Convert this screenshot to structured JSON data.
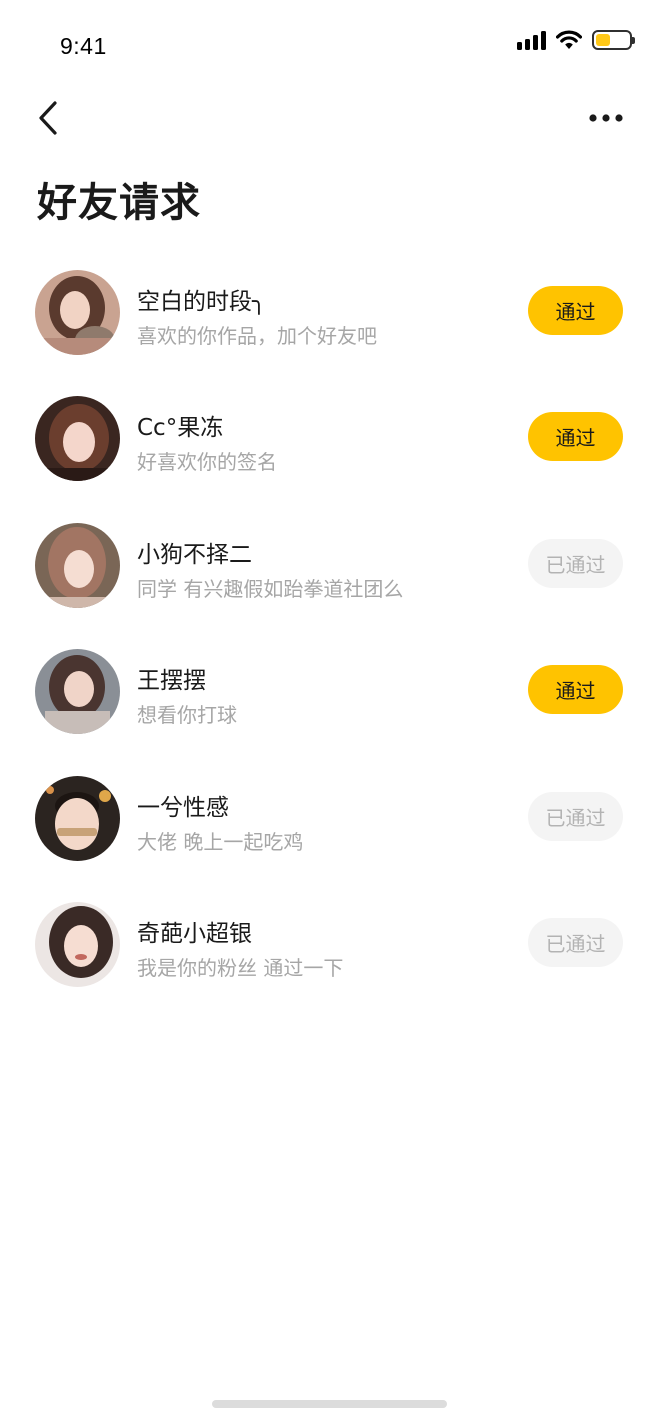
{
  "status_bar": {
    "time": "9:41",
    "battery_level": 0.45,
    "battery_color": "#FFC300",
    "signal_icon": "cellular-signal-icon",
    "wifi_icon": "wifi-icon",
    "battery_icon": "battery-icon"
  },
  "nav": {
    "back_icon": "chevron-left-icon",
    "more_icon": "more-horizontal-icon"
  },
  "page": {
    "title": "好友请求"
  },
  "theme": {
    "accent": "#FFC300",
    "muted_text": "#a6a6a6",
    "done_button_bg": "#f4f4f4"
  },
  "requests": [
    {
      "name": "空白的时段╮",
      "message": "喜欢的你作品，加个好友吧",
      "action_label": "通过",
      "status": "pending"
    },
    {
      "name": "Cc°果冻",
      "message": "好喜欢你的签名",
      "action_label": "通过",
      "status": "pending"
    },
    {
      "name": "小狗不择二",
      "message": "同学 有兴趣假如跆拳道社团么",
      "action_label": "已通过",
      "status": "done"
    },
    {
      "name": "王摆摆",
      "message": "想看你打球",
      "action_label": "通过",
      "status": "pending"
    },
    {
      "name": "一兮性感",
      "message": "大佬 晚上一起吃鸡",
      "action_label": "已通过",
      "status": "done"
    },
    {
      "name": "奇葩小超银",
      "message": "我是你的粉丝 通过一下",
      "action_label": "已通过",
      "status": "done"
    }
  ]
}
